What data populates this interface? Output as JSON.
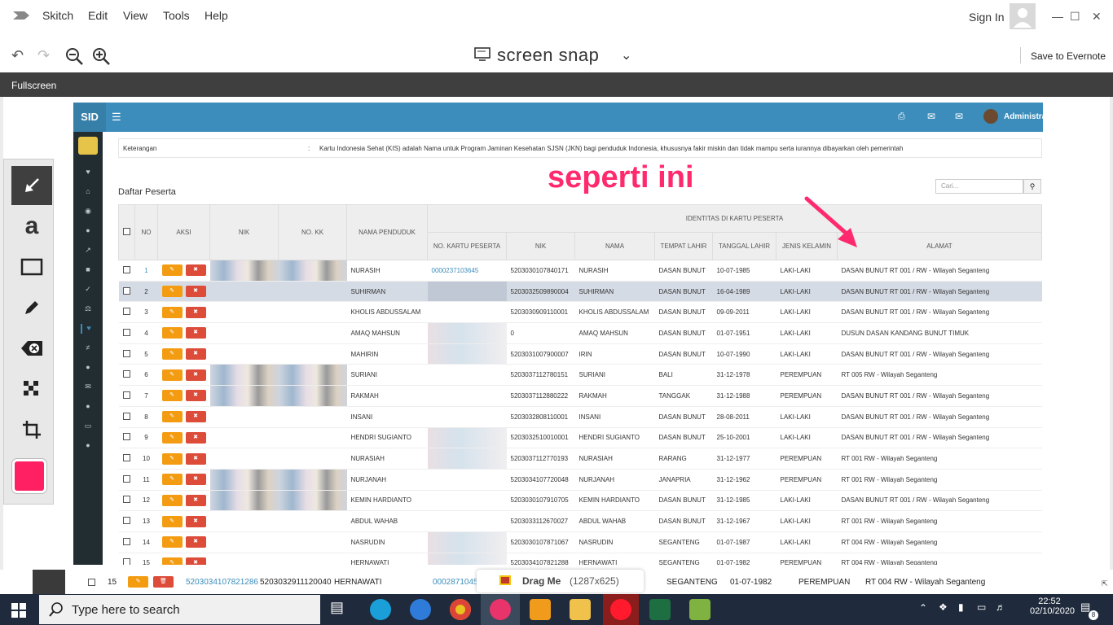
{
  "app": {
    "menus": [
      "Skitch",
      "Edit",
      "View",
      "Tools",
      "Help"
    ],
    "sign_in": "Sign In",
    "title": "screen snap",
    "save_to": "Save to Evernote",
    "fullscreen": "Fullscreen"
  },
  "sid": {
    "logo": "SID",
    "admin": "Administra",
    "ket_label": "Keterangan",
    "ket_sep": ":",
    "ket_text": "Kartu Indonesia Sehat (KIS) adalah Nama untuk Program Jaminan Kesehatan SJSN (JKN) bagi penduduk Indonesia, khususnya fakir miskin dan tidak mampu serta iurannya dibayarkan oleh pemerintah",
    "daftar": "Daftar Peserta",
    "search_placeholder": "Cari...",
    "headers": {
      "no": "NO",
      "aksi": "AKSI",
      "nik": "NIK",
      "nokk": "NO. KK",
      "nama": "NAMA PENDUDUK",
      "identitas": "IDENTITAS DI KARTU PESERTA",
      "nokartu": "NO. KARTU PESERTA",
      "nik2": "NIK",
      "nama2": "NAMA",
      "tempat": "TEMPAT LAHIR",
      "tanggal": "TANGGAL LAHIR",
      "jk": "JENIS KELAMIN",
      "alamat": "ALAMAT"
    },
    "rows": [
      {
        "no": "1",
        "nama": "NURASIH",
        "kartu": "0000237103645",
        "nik2": "5203030107840171",
        "nama2": "NURASIH",
        "tempat": "DASAN BUNUT",
        "tgl": "10-07-1985",
        "jk": "LAKI-LAKI",
        "alamat": "DASAN BUNUT RT 001 / RW - Wilayah Seganteng"
      },
      {
        "no": "2",
        "nama": "SUHIRMAN",
        "kartu": "",
        "nik2": "5203032509890004",
        "nama2": "SUHIRMAN",
        "tempat": "DASAN BUNUT",
        "tgl": "16-04-1989",
        "jk": "LAKI-LAKI",
        "alamat": "DASAN BUNUT RT 001 / RW - Wilayah Seganteng"
      },
      {
        "no": "3",
        "nama": "KHOLIS ABDUSSALAM",
        "kartu": "",
        "nik2": "5203030909110001",
        "nama2": "KHOLIS ABDUSSALAM",
        "tempat": "DASAN BUNUT",
        "tgl": "09-09-2011",
        "jk": "LAKI-LAKI",
        "alamat": "DASAN BUNUT RT 001 / RW - Wilayah Seganteng"
      },
      {
        "no": "4",
        "nama": "AMAQ MAHSUN",
        "kartu": "",
        "nik2": "0",
        "nama2": "AMAQ MAHSUN",
        "tempat": "DASAN BUNUT",
        "tgl": "01-07-1951",
        "jk": "LAKI-LAKI",
        "alamat": "DUSUN DASAN KANDANG BUNUT TIMUK"
      },
      {
        "no": "5",
        "nama": "MAHIRIN",
        "kartu": "",
        "nik2": "5203031007900007",
        "nama2": "IRIN",
        "tempat": "DASAN BUNUT",
        "tgl": "10-07-1990",
        "jk": "LAKI-LAKI",
        "alamat": "DASAN BUNUT RT 001 / RW - Wilayah Seganteng"
      },
      {
        "no": "6",
        "nama": "SURIANI",
        "kartu": "",
        "nik2": "5203037112780151",
        "nama2": "SURIANI",
        "tempat": "BALI",
        "tgl": "31-12-1978",
        "jk": "PEREMPUAN",
        "alamat": "RT 005 RW - Wilayah Seganteng"
      },
      {
        "no": "7",
        "nama": "RAKMAH",
        "kartu": "",
        "nik2": "5203037112880222",
        "nama2": "RAKMAH",
        "tempat": "TANGGAK",
        "tgl": "31-12-1988",
        "jk": "PEREMPUAN",
        "alamat": "DASAN BUNUT RT 001 / RW - Wilayah Seganteng"
      },
      {
        "no": "8",
        "nama": "INSANI",
        "kartu": "",
        "nik2": "5203032808110001",
        "nama2": "INSANI",
        "tempat": "DASAN BUNUT",
        "tgl": "28-08-2011",
        "jk": "LAKI-LAKI",
        "alamat": "DASAN BUNUT RT 001 / RW - Wilayah Seganteng"
      },
      {
        "no": "9",
        "nama": "HENDRI SUGIANTO",
        "kartu": "",
        "nik2": "5203032510010001",
        "nama2": "HENDRI SUGIANTO",
        "tempat": "DASAN BUNUT",
        "tgl": "25-10-2001",
        "jk": "LAKI-LAKI",
        "alamat": "DASAN BUNUT RT 001 / RW - Wilayah Seganteng"
      },
      {
        "no": "10",
        "nama": "NURASIAH",
        "kartu": "",
        "nik2": "5203037112770193",
        "nama2": "NURASIAH",
        "tempat": "RARANG",
        "tgl": "31-12-1977",
        "jk": "PEREMPUAN",
        "alamat": "RT 001 RW - Wilayah Seganteng"
      },
      {
        "no": "11",
        "nama": "NURJANAH",
        "kartu": "",
        "nik2": "5203034107720048",
        "nama2": "NURJANAH",
        "tempat": "JANAPRIA",
        "tgl": "31-12-1962",
        "jk": "PEREMPUAN",
        "alamat": "RT 001 RW - Wilayah Seganteng"
      },
      {
        "no": "12",
        "nama": "KEMIN HARDIANTO",
        "kartu": "",
        "nik2": "5203030107910705",
        "nama2": "KEMIN HARDIANTO",
        "tempat": "DASAN BUNUT",
        "tgl": "31-12-1985",
        "jk": "LAKI-LAKI",
        "alamat": "DASAN BUNUT RT 001 / RW - Wilayah Seganteng"
      },
      {
        "no": "13",
        "nama": "ABDUL WAHAB",
        "kartu": "",
        "nik2": "5203033112670027",
        "nama2": "ABDUL WAHAB",
        "tempat": "DASAN BUNUT",
        "tgl": "31-12-1967",
        "jk": "LAKI-LAKI",
        "alamat": "RT 001 RW - Wilayah Seganteng"
      },
      {
        "no": "14",
        "nama": "NASRUDIN",
        "kartu": "",
        "nik2": "5203030107871067",
        "nama2": "NASRUDIN",
        "tempat": "SEGANTENG",
        "tgl": "01-07-1987",
        "jk": "LAKI-LAKI",
        "alamat": "RT 004 RW - Wilayah Seganteng"
      },
      {
        "no": "15",
        "nama": "HERNAWATI",
        "kartu": "",
        "nik2": "5203034107821288",
        "nama2": "HERNAWATI",
        "tempat": "SEGANTENG",
        "tgl": "01-07-1982",
        "jk": "PEREMPUAN",
        "alamat": "RT 004 RW - Wilayah Seganteng"
      }
    ]
  },
  "annotation": "seperti ini",
  "drag": {
    "no": "15",
    "nik": "5203034107821286",
    "nokk": "5203032911120040",
    "nama": "HERNAWATI",
    "kartu": "0002871045",
    "label": "Drag Me",
    "size": "(1287x625)",
    "tempat": "SEGANTENG",
    "tgl": "01-07-1982",
    "jk": "PEREMPUAN",
    "alamat": "RT 004 RW - Wilayah Seganteng"
  },
  "taskbar": {
    "search": "Type here to search",
    "time": "22:52",
    "date": "02/10/2020",
    "notif": "8"
  },
  "colors": {
    "annotation": "#ff2a6d",
    "header": "#3c8dbc",
    "sidebar": "#222d32",
    "edit": "#f39c12",
    "delete": "#dd4b39",
    "swatch": "#ff1f63"
  }
}
